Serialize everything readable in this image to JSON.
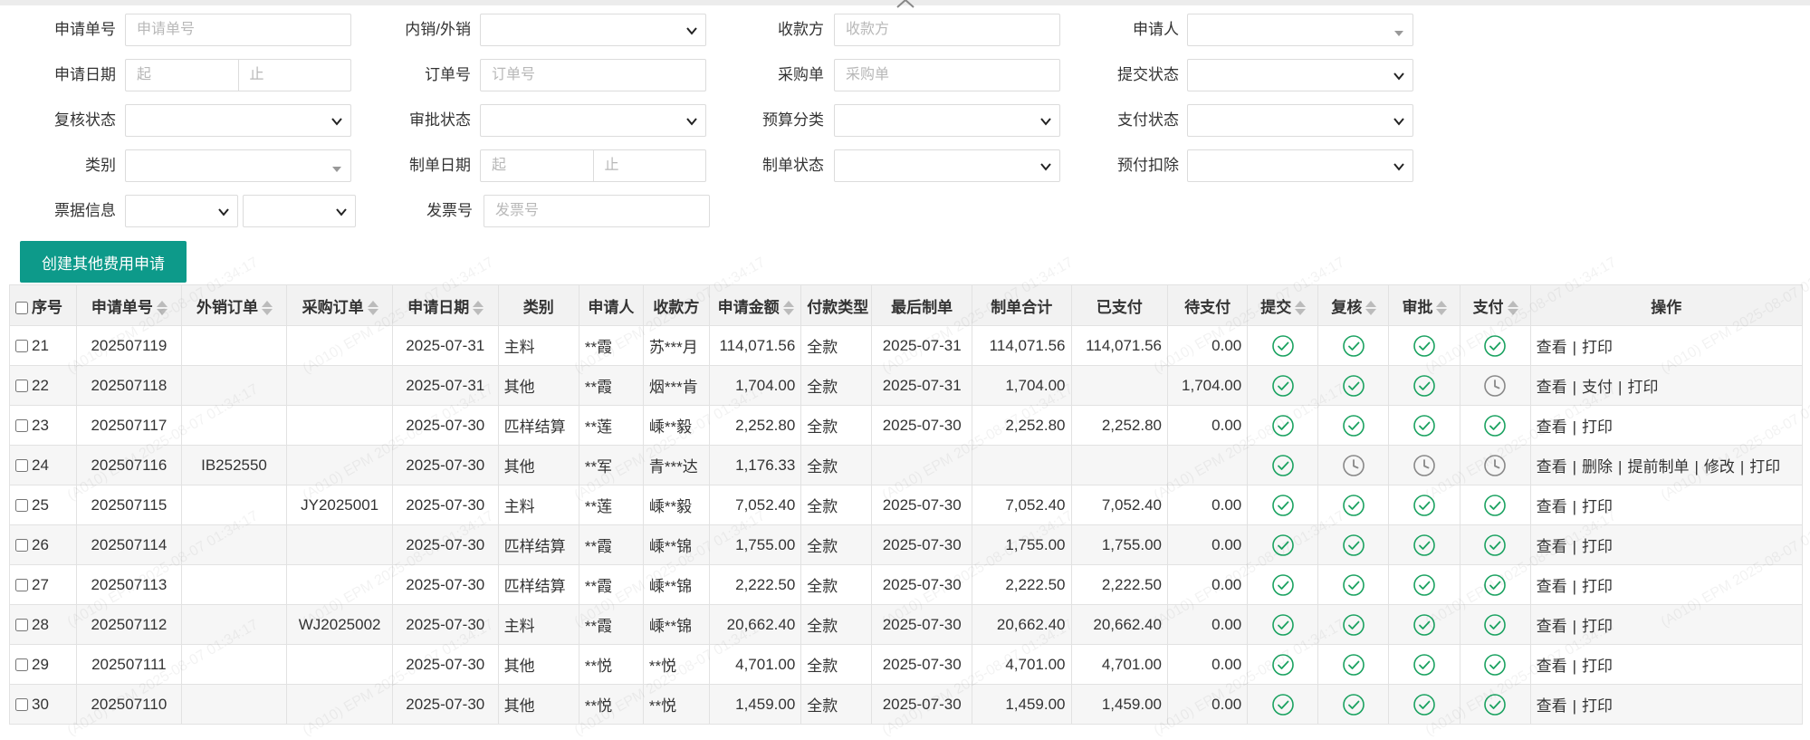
{
  "filters": {
    "req_no": {
      "label": "申请单号",
      "placeholder": "申请单号"
    },
    "domestic_export": {
      "label": "内销/外销",
      "value": ""
    },
    "payee": {
      "label": "收款方",
      "placeholder": "收款方"
    },
    "applicant": {
      "label": "申请人",
      "value": ""
    },
    "apply_date": {
      "label": "申请日期",
      "from_placeholder": "起",
      "to_placeholder": "止"
    },
    "order_no": {
      "label": "订单号",
      "placeholder": "订单号"
    },
    "purchase_no": {
      "label": "采购单",
      "placeholder": "采购单"
    },
    "submit_status": {
      "label": "提交状态",
      "value": ""
    },
    "review_status": {
      "label": "复核状态",
      "value": ""
    },
    "approve_status": {
      "label": "审批状态",
      "value": ""
    },
    "budget_category": {
      "label": "预算分类",
      "value": ""
    },
    "pay_status": {
      "label": "支付状态",
      "value": ""
    },
    "category": {
      "label": "类别",
      "value": ""
    },
    "doc_date": {
      "label": "制单日期",
      "from_placeholder": "起",
      "to_placeholder": "止"
    },
    "doc_status": {
      "label": "制单状态",
      "value": ""
    },
    "prepay_deduct": {
      "label": "预付扣除",
      "value": ""
    },
    "invoice_info": {
      "label": "票据信息",
      "value1": "",
      "value2": ""
    },
    "invoice_no": {
      "label": "发票号",
      "placeholder": "发票号"
    }
  },
  "create_button": "创建其他费用申请",
  "table": {
    "headers": {
      "seq": "序号",
      "req_no": "申请单号",
      "ext_order": "外销订单",
      "po": "采购订单",
      "date": "申请日期",
      "category": "类别",
      "applicant": "申请人",
      "payee": "收款方",
      "amount": "申请金额",
      "pay_type": "付款类型",
      "last_doc": "最后制单",
      "doc_total": "制单合计",
      "paid": "已支付",
      "pending": "待支付",
      "submit": "提交",
      "review": "复核",
      "approve": "审批",
      "payment": "支付",
      "actions": "操作"
    },
    "rows": [
      {
        "seq": "21",
        "req_no": "202507119",
        "ext_order": "",
        "po": "",
        "date": "2025-07-31",
        "category": "主料",
        "applicant": "**霞",
        "payee": "苏***月",
        "amount": "114,071.56",
        "pay_type": "全款",
        "last_doc": "2025-07-31",
        "doc_total": "114,071.56",
        "paid": "114,071.56",
        "pending": "0.00",
        "submit": "done",
        "review": "done",
        "approve": "done",
        "payment": "done",
        "actions": [
          "查看",
          "打印"
        ]
      },
      {
        "seq": "22",
        "req_no": "202507118",
        "ext_order": "",
        "po": "",
        "date": "2025-07-31",
        "category": "其他",
        "applicant": "**霞",
        "payee": "烟***肯",
        "amount": "1,704.00",
        "pay_type": "全款",
        "last_doc": "2025-07-31",
        "doc_total": "1,704.00",
        "paid": "",
        "pending": "1,704.00",
        "submit": "done",
        "review": "done",
        "approve": "done",
        "payment": "pending",
        "actions": [
          "查看",
          "支付",
          "打印"
        ]
      },
      {
        "seq": "23",
        "req_no": "202507117",
        "ext_order": "",
        "po": "",
        "date": "2025-07-30",
        "category": "匹样结算",
        "applicant": "**莲",
        "payee": "嵊**毅",
        "amount": "2,252.80",
        "pay_type": "全款",
        "last_doc": "2025-07-30",
        "doc_total": "2,252.80",
        "paid": "2,252.80",
        "pending": "0.00",
        "submit": "done",
        "review": "done",
        "approve": "done",
        "payment": "done",
        "actions": [
          "查看",
          "打印"
        ]
      },
      {
        "seq": "24",
        "req_no": "202507116",
        "ext_order": "IB252550",
        "po": "",
        "date": "2025-07-30",
        "category": "其他",
        "applicant": "**军",
        "payee": "青***达",
        "amount": "1,176.33",
        "pay_type": "全款",
        "last_doc": "",
        "doc_total": "",
        "paid": "",
        "pending": "",
        "submit": "done",
        "review": "pending",
        "approve": "pending",
        "payment": "pending",
        "actions": [
          "查看",
          "删除",
          "提前制单",
          "修改",
          "打印"
        ]
      },
      {
        "seq": "25",
        "req_no": "202507115",
        "ext_order": "",
        "po": "JY2025001",
        "date": "2025-07-30",
        "category": "主料",
        "applicant": "**莲",
        "payee": "嵊**毅",
        "amount": "7,052.40",
        "pay_type": "全款",
        "last_doc": "2025-07-30",
        "doc_total": "7,052.40",
        "paid": "7,052.40",
        "pending": "0.00",
        "submit": "done",
        "review": "done",
        "approve": "done",
        "payment": "done",
        "actions": [
          "查看",
          "打印"
        ]
      },
      {
        "seq": "26",
        "req_no": "202507114",
        "ext_order": "",
        "po": "",
        "date": "2025-07-30",
        "category": "匹样结算",
        "applicant": "**霞",
        "payee": "嵊**锦",
        "amount": "1,755.00",
        "pay_type": "全款",
        "last_doc": "2025-07-30",
        "doc_total": "1,755.00",
        "paid": "1,755.00",
        "pending": "0.00",
        "submit": "done",
        "review": "done",
        "approve": "done",
        "payment": "done",
        "actions": [
          "查看",
          "打印"
        ]
      },
      {
        "seq": "27",
        "req_no": "202507113",
        "ext_order": "",
        "po": "",
        "date": "2025-07-30",
        "category": "匹样结算",
        "applicant": "**霞",
        "payee": "嵊**锦",
        "amount": "2,222.50",
        "pay_type": "全款",
        "last_doc": "2025-07-30",
        "doc_total": "2,222.50",
        "paid": "2,222.50",
        "pending": "0.00",
        "submit": "done",
        "review": "done",
        "approve": "done",
        "payment": "done",
        "actions": [
          "查看",
          "打印"
        ]
      },
      {
        "seq": "28",
        "req_no": "202507112",
        "ext_order": "",
        "po": "WJ2025002",
        "date": "2025-07-30",
        "category": "主料",
        "applicant": "**霞",
        "payee": "嵊**锦",
        "amount": "20,662.40",
        "pay_type": "全款",
        "last_doc": "2025-07-30",
        "doc_total": "20,662.40",
        "paid": "20,662.40",
        "pending": "0.00",
        "submit": "done",
        "review": "done",
        "approve": "done",
        "payment": "done",
        "actions": [
          "查看",
          "打印"
        ]
      },
      {
        "seq": "29",
        "req_no": "202507111",
        "ext_order": "",
        "po": "",
        "date": "2025-07-30",
        "category": "其他",
        "applicant": "**悦",
        "payee": "**悦",
        "amount": "4,701.00",
        "pay_type": "全款",
        "last_doc": "2025-07-30",
        "doc_total": "4,701.00",
        "paid": "4,701.00",
        "pending": "0.00",
        "submit": "done",
        "review": "done",
        "approve": "done",
        "payment": "done",
        "actions": [
          "查看",
          "打印"
        ]
      },
      {
        "seq": "30",
        "req_no": "202507110",
        "ext_order": "",
        "po": "",
        "date": "2025-07-30",
        "category": "其他",
        "applicant": "**悦",
        "payee": "**悦",
        "amount": "1,459.00",
        "pay_type": "全款",
        "last_doc": "2025-07-30",
        "doc_total": "1,459.00",
        "paid": "1,459.00",
        "pending": "0.00",
        "submit": "done",
        "review": "done",
        "approve": "done",
        "payment": "done",
        "actions": [
          "查看",
          "打印"
        ]
      }
    ]
  },
  "watermark": "(A010) EPM 2025-08-07 01:34:17",
  "colors": {
    "accent": "#0d9a8a",
    "status_done": "#1aa260",
    "status_pending": "#888888"
  }
}
